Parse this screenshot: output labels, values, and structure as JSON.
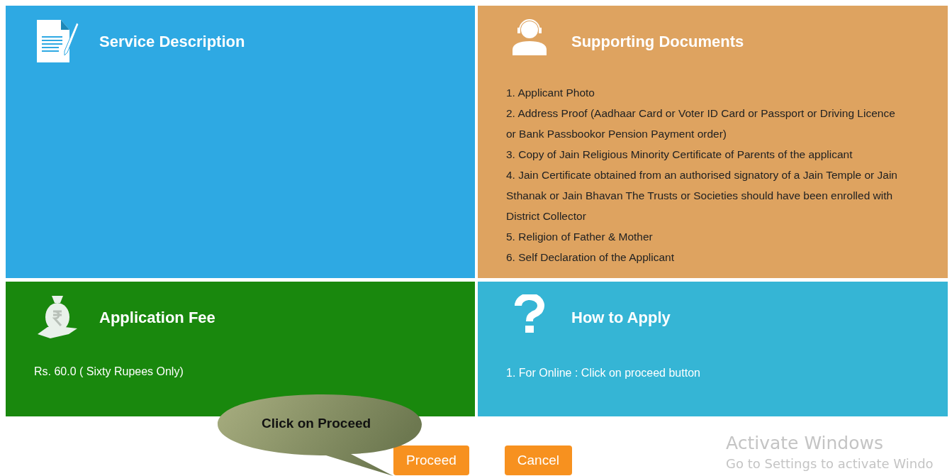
{
  "panels": [
    {
      "kind": "description",
      "title": "Service Description",
      "color": "#2ea9e3"
    },
    {
      "kind": "documents",
      "title": "Supporting Documents",
      "color": "#dea360",
      "items": [
        "1. Applicant Photo",
        "2. Address Proof (Aadhaar Card or Voter ID Card or Passport or Driving Licence or Bank Passbookor Pension Payment order)",
        "3. Copy of Jain Religious Minority Certificate of Parents of the applicant",
        "4. Jain Certificate obtained from an authorised signatory of a Jain Temple or Jain Sthanak or Jain Bhavan The Trusts or Societies should have been enrolled with District Collector",
        "5. Religion of Father & Mother",
        "6. Self Declaration of the Applicant"
      ]
    },
    {
      "kind": "fee",
      "title": "Application Fee",
      "color": "#19880d",
      "items": [
        "Rs. 60.0 ( Sixty Rupees Only)"
      ]
    },
    {
      "kind": "help",
      "title": "How to Apply",
      "color": "#35b5d5",
      "items": [
        "1. For Online : Click on proceed button"
      ]
    }
  ],
  "callout": {
    "text": "Click on Proceed"
  },
  "buttons": [
    "Proceed",
    "Cancel"
  ],
  "activation_notice": {
    "title": "Activate Windows",
    "message": "Go to Settings to activate Windo"
  }
}
